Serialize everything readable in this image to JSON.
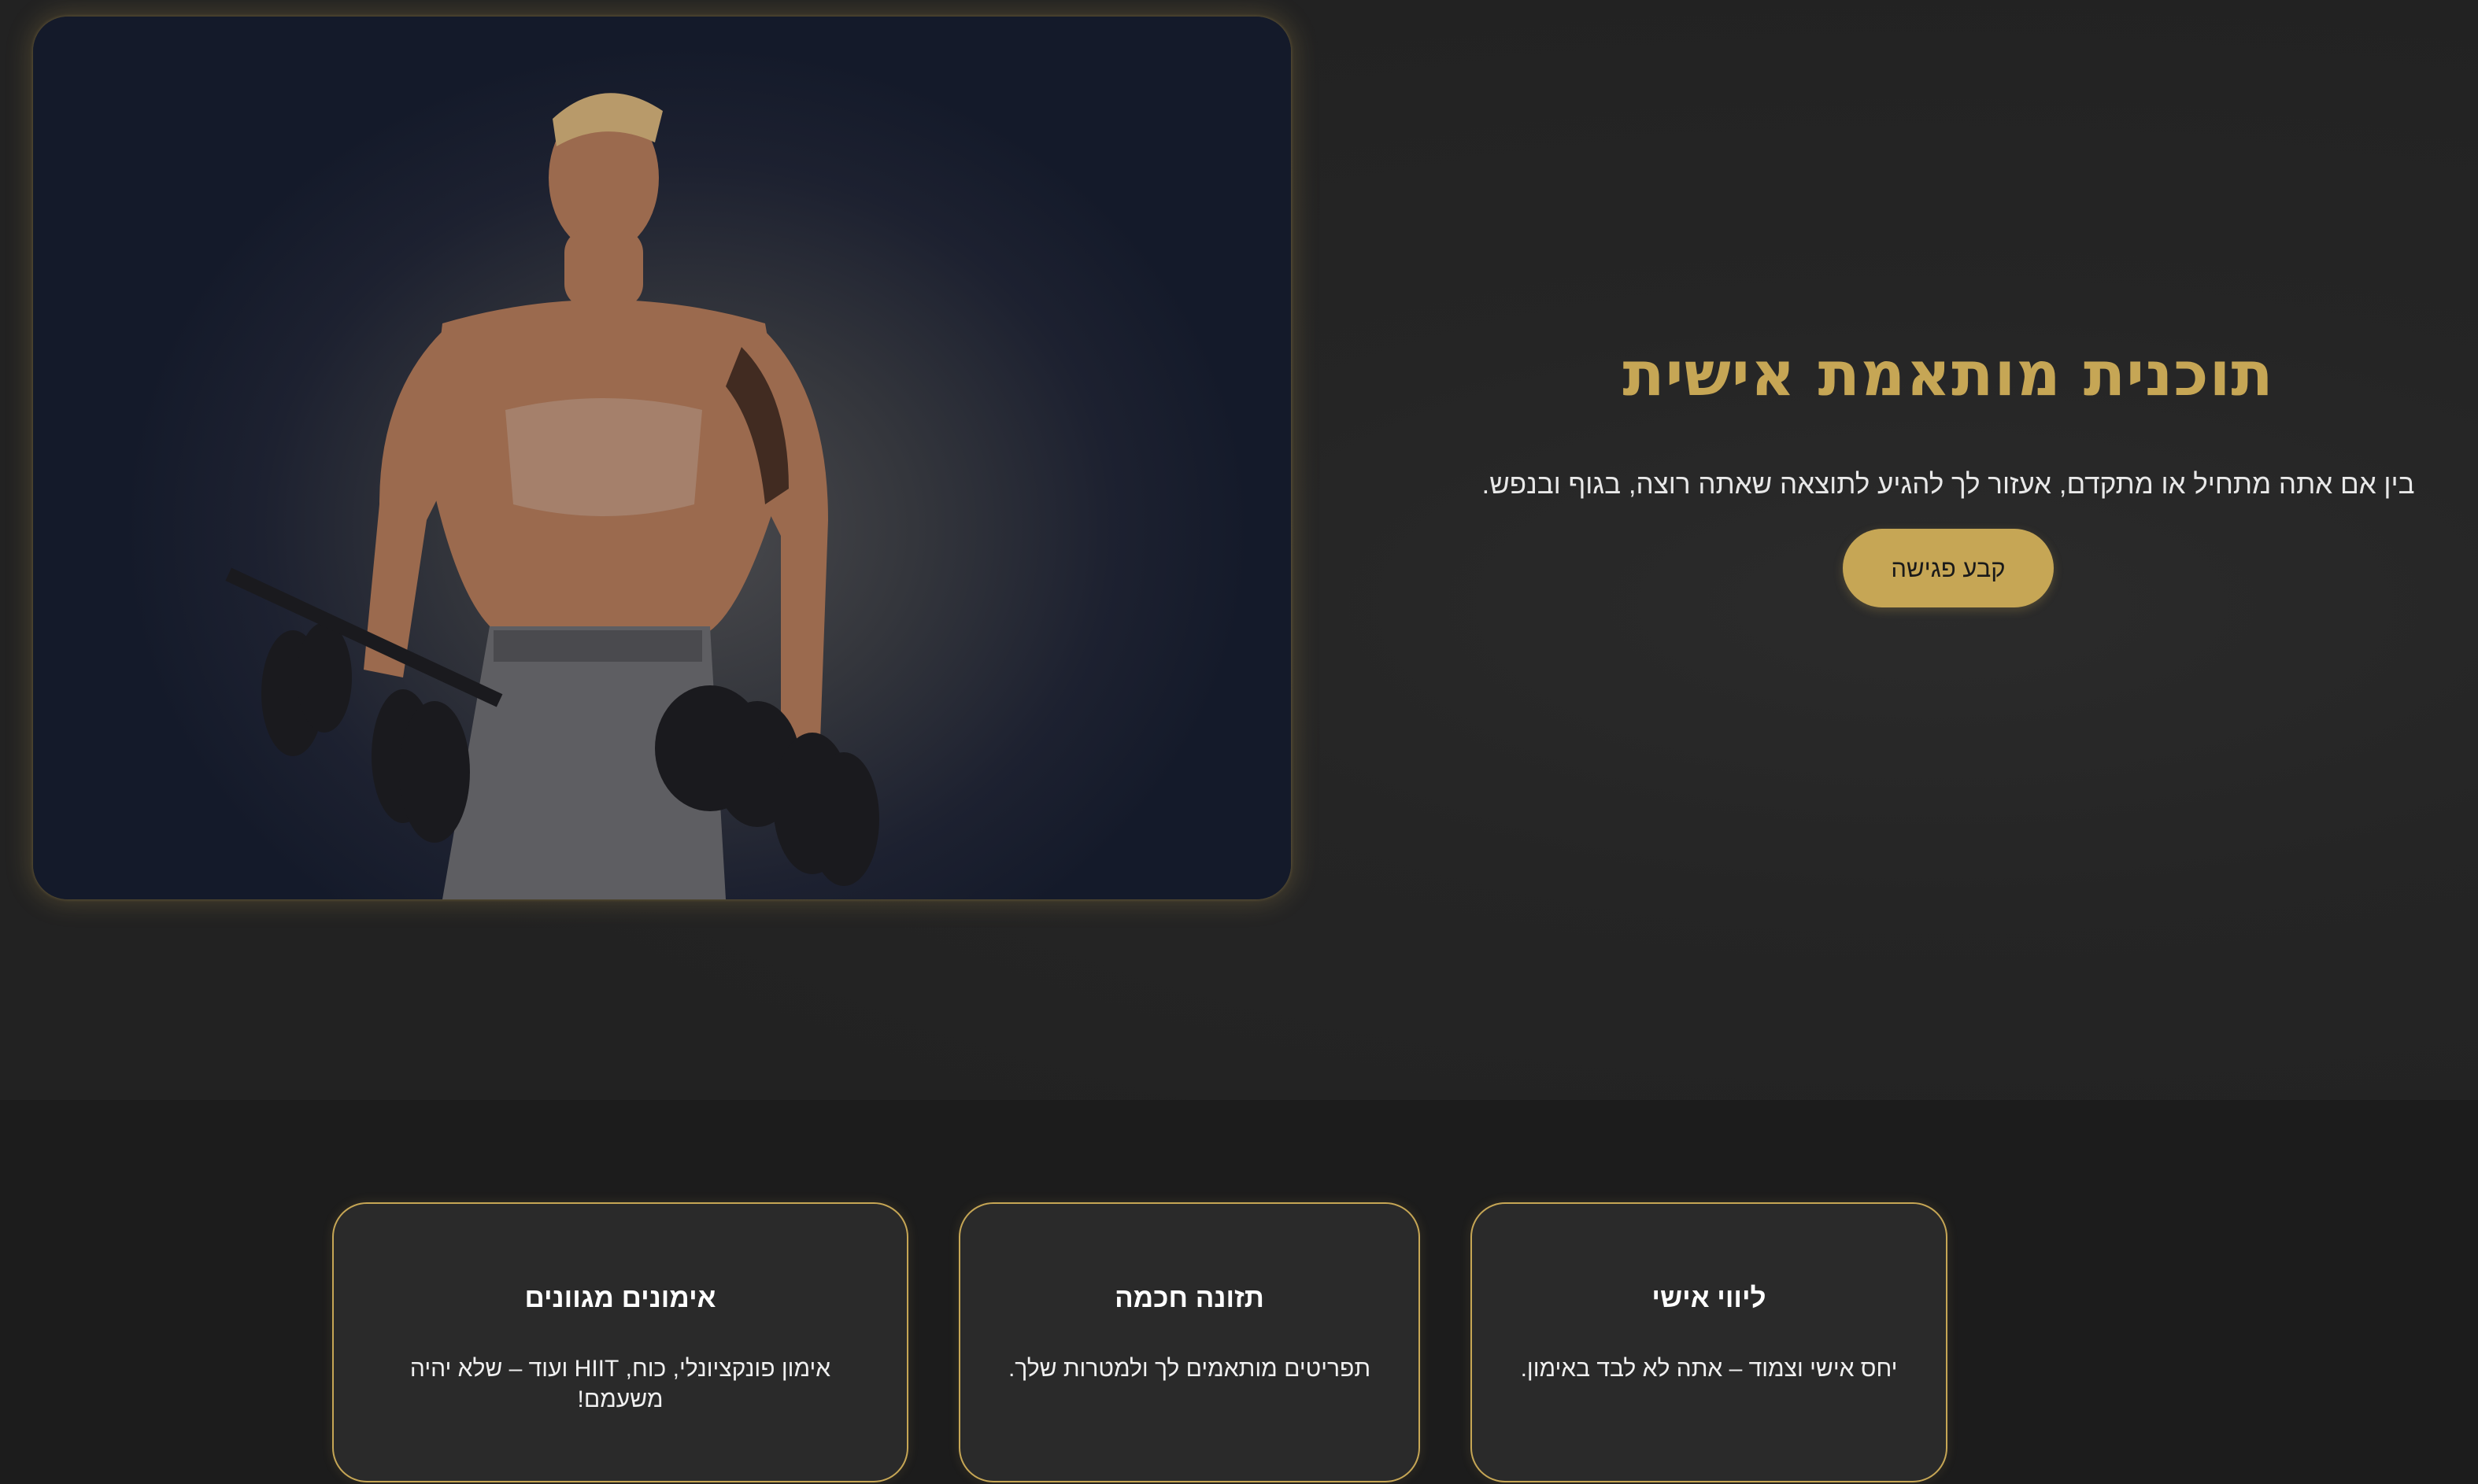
{
  "hero": {
    "title": "תוכנית מותאמת אישית",
    "subtitle": "בין אם אתה מתחיל או מתקדם, אעזור לך להגיע לתוצאה שאתה רוצה, בגוף ובנפש.",
    "cta_label": "קבע פגישה"
  },
  "features": [
    {
      "title": "ליווי אישי",
      "text": "יחס אישי וצמוד – אתה לא לבד באימון."
    },
    {
      "title": "תזונה חכמה",
      "text": "תפריטים מותאמים לך ולמטרות שלך."
    },
    {
      "title": "אימונים מגוונים",
      "text": "אימון פונקציונלי, כוח, HIIT ועוד – שלא יהיה משעמם!"
    }
  ],
  "colors": {
    "accent": "#c6a655",
    "background": "#1f1f1f",
    "card_background": "#2a2a2a"
  }
}
